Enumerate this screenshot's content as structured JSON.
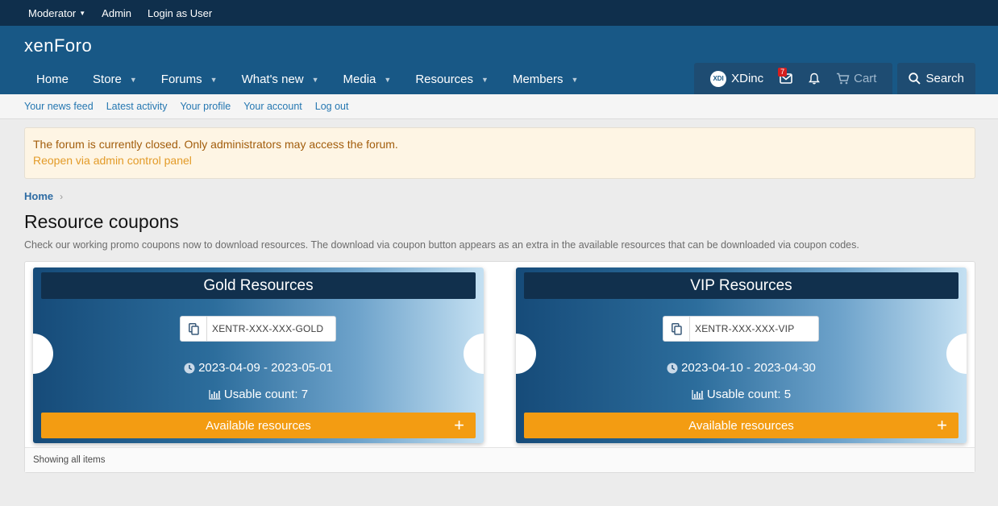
{
  "staffbar": {
    "moderator": "Moderator",
    "admin": "Admin",
    "login_as_user": "Login as User"
  },
  "header": {
    "logo": "xenForo"
  },
  "nav": {
    "tabs": [
      "Home",
      "Store",
      "Forums",
      "What's new",
      "Media",
      "Resources",
      "Members"
    ],
    "user": {
      "name": "XDinc",
      "avatar_text": "XDI",
      "inbox_badge": "7",
      "cart": "Cart",
      "search": "Search"
    }
  },
  "subnav": [
    "Your news feed",
    "Latest activity",
    "Your profile",
    "Your account",
    "Log out"
  ],
  "notice": {
    "message": "The forum is currently closed. Only administrators may access the forum.",
    "link": "Reopen via admin control panel"
  },
  "breadcrumb": {
    "home": "Home"
  },
  "page": {
    "title": "Resource coupons",
    "description": "Check our working promo coupons now to download resources. The download via coupon button appears as an extra in the available resources that can be downloaded via coupon codes."
  },
  "coupons": [
    {
      "title": "Gold Resources",
      "code": "XENTR-XXX-XXX-GOLD",
      "dates": "2023-04-09 - 2023-05-01",
      "usable": "Usable count: 7",
      "button": "Available resources"
    },
    {
      "title": "VIP Resources",
      "code": "XENTR-XXX-XXX-VIP",
      "dates": "2023-04-10 - 2023-04-30",
      "usable": "Usable count: 5",
      "button": "Available resources"
    }
  ],
  "footer": {
    "text": "Showing all items"
  },
  "colors": {
    "header": "#185886",
    "staffbar": "#0f2f4c",
    "accent": "#f39c12",
    "notice_bg": "#fef5e4"
  }
}
